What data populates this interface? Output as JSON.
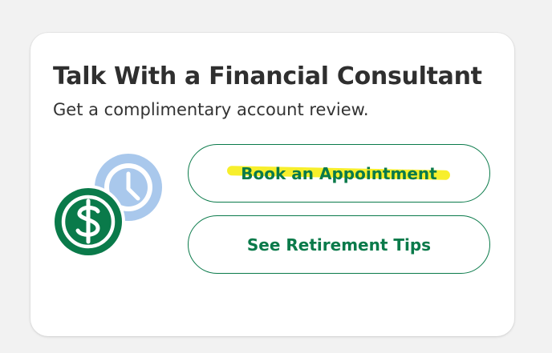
{
  "card": {
    "title": "Talk With a Financial Consultant",
    "subtitle": "Get a complimentary account review."
  },
  "illustration": {
    "icons": [
      "clock-icon",
      "dollar-coin-icon"
    ],
    "colors": {
      "clock": "#a9c8ec",
      "coin": "#0a7a4a"
    }
  },
  "buttons": {
    "book_label": "Book an Appointment",
    "tips_label": "See Retirement Tips"
  },
  "colors": {
    "background": "#f2f2f2",
    "card": "#ffffff",
    "accent": "#0a7a4a",
    "title_text": "#2f2f2f",
    "highlight": "#f7ef2c"
  }
}
